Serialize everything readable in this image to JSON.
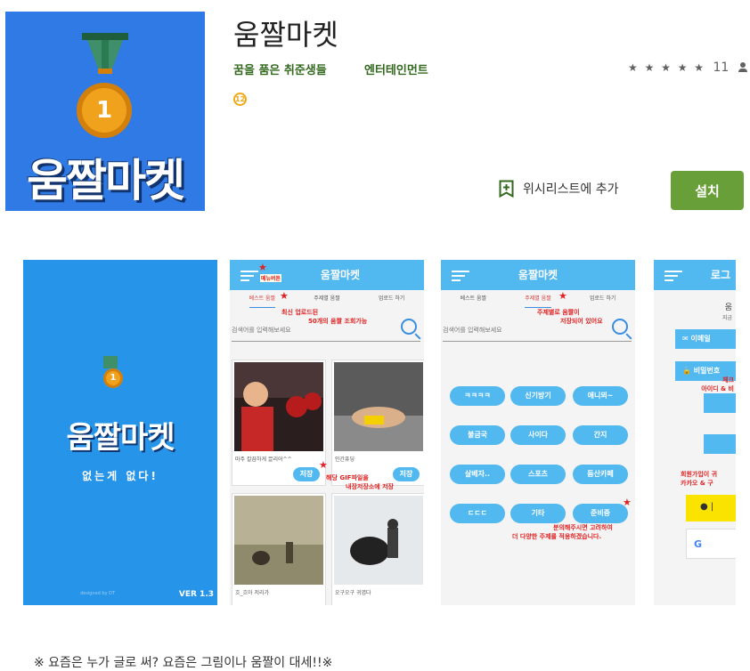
{
  "app": {
    "title": "움짤마켓",
    "developer": "꿈을 품은 취준생들",
    "category": "엔터테인먼트",
    "age_rating": "12",
    "rating_stars": "★ ★ ★ ★ ★",
    "rating_count": "11",
    "wishlist_label": "위시리스트에 추가",
    "install_label": "설치",
    "icon_text": "움짤마켓",
    "icon_medal_number": "1"
  },
  "colors": {
    "accent_green": "#689f38",
    "icon_blue": "#2f7ae5",
    "app_blue": "#52b9f0",
    "annotation_red": "#e02222"
  },
  "screenshots": {
    "s1": {
      "title": "움짤마켓",
      "tagline": "없는게 없다!",
      "designed_by": "designed by DT",
      "version": "VER 1.3",
      "medal_number": "1"
    },
    "s2": {
      "appbar_title": "움짤마켓",
      "menu_note": "메뉴버튼",
      "tabs": [
        "베스트 움짤",
        "주제별 움짤",
        "업로드 하기"
      ],
      "note_top": "최신 업로드된",
      "note_top2": "50개의 움짤 조회가능",
      "search_placeholder": "검색어를 입력해보세요",
      "cards": [
        {
          "caption": "마주 칼끔하게 끌리어^^",
          "save": "저장"
        },
        {
          "caption": "인간퓨딩",
          "save": "저장"
        },
        {
          "caption": "흐_흐아 저리가",
          "save": ""
        },
        {
          "caption": "오구오구 귀엽다",
          "save": ""
        }
      ],
      "note_save": "해당 GIF파일을",
      "note_save2": "내장저장소에 저장"
    },
    "s3": {
      "appbar_title": "움짤마켓",
      "tabs": [
        "베스트 움짤",
        "주제별 움짤",
        "업로드 하기"
      ],
      "note_top": "주제별로 움짤이",
      "note_top2": "저장되어 있어요",
      "search_placeholder": "검색어를 입력해보세요",
      "categories": [
        "ㅋㅋㅋㅋ",
        "신기방기",
        "애니뫼~",
        "불금국",
        "사이다",
        "간지",
        "살베자..",
        "스포츠",
        "듬산카페",
        "ㄷㄷㄷ",
        "기타",
        "준비중"
      ],
      "note_bottom": "분의해주시면 고려하여",
      "note_bottom2": "더 다양한 주제를 적용하겠습니다."
    },
    "s4": {
      "appbar_title": "로그",
      "line1": "움",
      "line2": "지금",
      "email_label": "이메일",
      "password_label": "비밀번호",
      "note1": "체크",
      "note2": "아이디 & 비",
      "note3": "회원가입이 귀",
      "note4": "카카오 & 구",
      "kakao_label": "|",
      "google_label": "G"
    }
  },
  "description": "※ 요즘은 누가 글로 써? 요즘은 그림이나 움짤이 대세!!※"
}
